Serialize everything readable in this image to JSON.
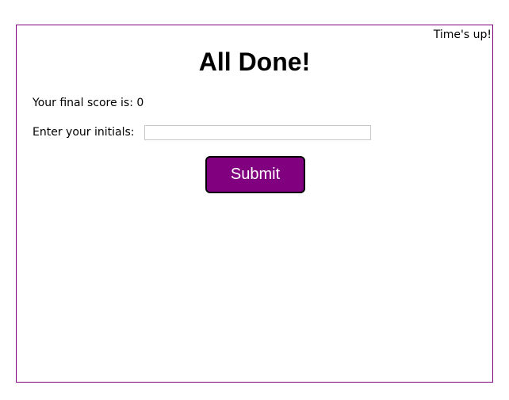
{
  "timer": {
    "text": "Time's up!"
  },
  "main": {
    "title": "All Done!",
    "score_prefix": "Your final score is: ",
    "score_value": "0",
    "initials_label": "Enter your initials:",
    "initials_value": "",
    "submit_label": "Submit"
  },
  "colors": {
    "accent": "#800080",
    "button_text": "#ffffff",
    "button_border": "#000000",
    "frame_border": "#800080"
  }
}
